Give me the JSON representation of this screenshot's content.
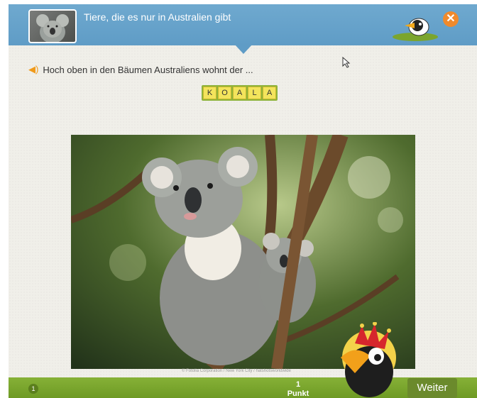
{
  "header": {
    "title": "Tiere, die es nur in Australien gibt",
    "close_icon": "close-icon",
    "close_glyph": "✕",
    "color": "#5f9cc6"
  },
  "question": {
    "speaker_icon": "speaker-icon",
    "speaker_glyph": "◀)",
    "text": "Hoch oben in den Bäumen Australiens wohnt der ..."
  },
  "answer": {
    "letters": [
      "K",
      "O",
      "A",
      "L",
      "A"
    ]
  },
  "photo": {
    "credit": "© Fotolia Corporation / New York City / hatshotsworldwide"
  },
  "footer": {
    "page": "1",
    "points_value": "1",
    "points_label": "Punkt",
    "next_label": "Weiter",
    "color": "#7ba52e"
  }
}
